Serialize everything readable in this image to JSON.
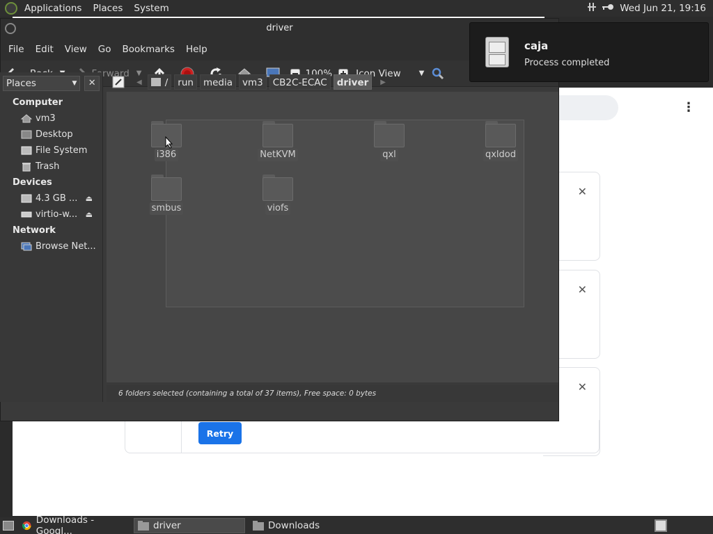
{
  "top_panel": {
    "menus": [
      "Applications",
      "Places",
      "System"
    ],
    "clock": "Wed Jun 21, 19:16"
  },
  "window": {
    "title": "driver",
    "menu": [
      "File",
      "Edit",
      "View",
      "Go",
      "Bookmarks",
      "Help"
    ],
    "toolbar": {
      "back": "Back",
      "forward": "Forward",
      "zoom": "100%",
      "view_mode": "Icon View"
    },
    "sidebar": {
      "selector": "Places",
      "sections": [
        {
          "title": "Computer",
          "items": [
            {
              "label": "vm3",
              "icon": "home-icon"
            },
            {
              "label": "Desktop",
              "icon": "desktop-icon"
            },
            {
              "label": "File System",
              "icon": "drive-icon"
            },
            {
              "label": "Trash",
              "icon": "trash-icon"
            }
          ]
        },
        {
          "title": "Devices",
          "items": [
            {
              "label": "4.3 GB ...",
              "icon": "drive-icon",
              "eject": true
            },
            {
              "label": "virtio-w...",
              "icon": "disc-icon",
              "eject": true
            }
          ]
        },
        {
          "title": "Network",
          "items": [
            {
              "label": "Browse Net...",
              "icon": "network-icon"
            }
          ]
        }
      ]
    },
    "path": [
      "/",
      "run",
      "media",
      "vm3",
      "CB2C-ECAC",
      "driver"
    ],
    "folders": [
      "i386",
      "NetKVM",
      "qxl",
      "qxldod",
      "smbus",
      "viofs"
    ],
    "status": "6 folders selected (containing a total of 37 items), Free space: 0 bytes"
  },
  "notification": {
    "title": "caja",
    "body": "Process completed"
  },
  "browser": {
    "retry_label": "Retry"
  },
  "taskbar": {
    "tasks": [
      "Downloads - Googl...",
      "driver",
      "Downloads"
    ]
  }
}
